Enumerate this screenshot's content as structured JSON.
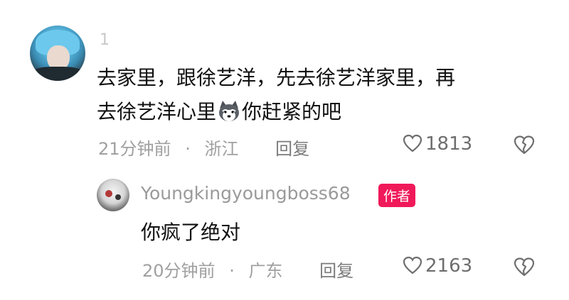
{
  "comment": {
    "username": "1",
    "text_line1": "去家里，跟徐艺洋，先去徐艺洋家里，再",
    "text_line2a": "去徐艺洋心里",
    "text_line2b": "你赶紧的吧",
    "emoji": "husky-dog-emoji",
    "time": "21分钟前",
    "dot": "·",
    "location": "浙江",
    "reply_label": "回复",
    "likes": "1813"
  },
  "reply": {
    "username": "Youngkingyoungboss68",
    "badge": "作者",
    "text": "你疯了绝对",
    "time": "20分钟前",
    "dot": "·",
    "location": "广东",
    "reply_label": "回复",
    "likes": "2163"
  },
  "colors": {
    "badge": "#f0195a",
    "meta": "#a0a0a0",
    "text": "#111111"
  }
}
